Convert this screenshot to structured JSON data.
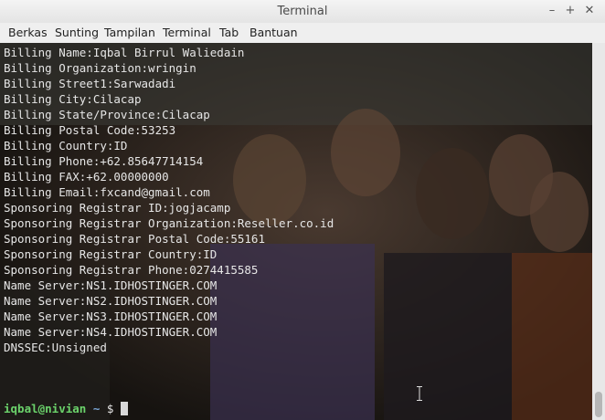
{
  "window": {
    "title": "Terminal"
  },
  "titlebar_buttons": [
    {
      "name": "minimize",
      "glyph": "–"
    },
    {
      "name": "maximize",
      "glyph": "+"
    },
    {
      "name": "close",
      "glyph": "✕"
    }
  ],
  "menu": [
    "Berkas",
    "Sunting",
    "Tampilan",
    "Terminal",
    "Tab",
    "Bantuan"
  ],
  "terminal": {
    "lines": [
      "Billing Name:Iqbal Birrul Waliedain",
      "Billing Organization:wringin",
      "Billing Street1:Sarwadadi",
      "Billing City:Cilacap",
      "Billing State/Province:Cilacap",
      "Billing Postal Code:53253",
      "Billing Country:ID",
      "Billing Phone:+62.85647714154",
      "Billing FAX:+62.00000000",
      "Billing Email:fxcand@gmail.com",
      "Sponsoring Registrar ID:jogjacamp",
      "Sponsoring Registrar Organization:Reseller.co.id",
      "Sponsoring Registrar Postal Code:55161",
      "Sponsoring Registrar Country:ID",
      "Sponsoring Registrar Phone:0274415585",
      "Name Server:NS1.IDHOSTINGER.COM",
      "Name Server:NS2.IDHOSTINGER.COM",
      "Name Server:NS3.IDHOSTINGER.COM",
      "Name Server:NS4.IDHOSTINGER.COM",
      "DNSSEC:Unsigned"
    ],
    "prompt": {
      "user_host": "iqbal@nivian",
      "path": "~",
      "symbol": "$"
    }
  },
  "colors": {
    "prompt_user": "#6bd36b",
    "prompt_path": "#7aa6d6",
    "text": "#e6e6e6",
    "background": "#0d0d0d"
  }
}
